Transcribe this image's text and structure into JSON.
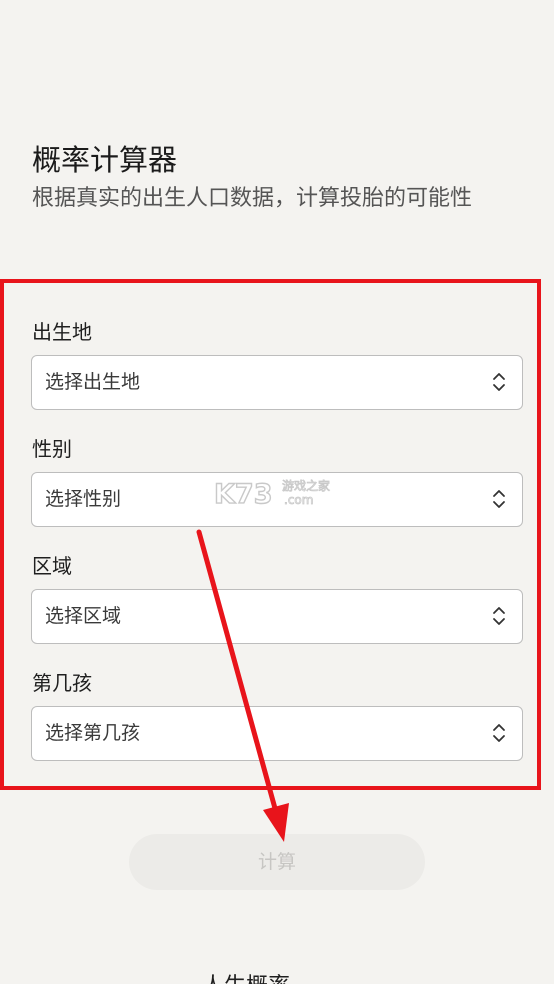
{
  "header": {
    "title": "概率计算器",
    "subtitle": "根据真实的出生人口数据，计算投胎的可能性"
  },
  "form": {
    "fields": [
      {
        "label": "出生地",
        "placeholder": "选择出生地"
      },
      {
        "label": "性别",
        "placeholder": "选择性别"
      },
      {
        "label": "区域",
        "placeholder": "选择区域"
      },
      {
        "label": "第几孩",
        "placeholder": "选择第几孩"
      }
    ],
    "chevron_icon": "chevron-up-down-icon"
  },
  "action": {
    "calculate_label": "计算"
  },
  "footer": {
    "partial_text": "人生概率"
  },
  "watermark": {
    "brand": "K73",
    "tagline": "游戏之家",
    "domain": ".com"
  },
  "annotation": {
    "color": "#e8141b"
  }
}
